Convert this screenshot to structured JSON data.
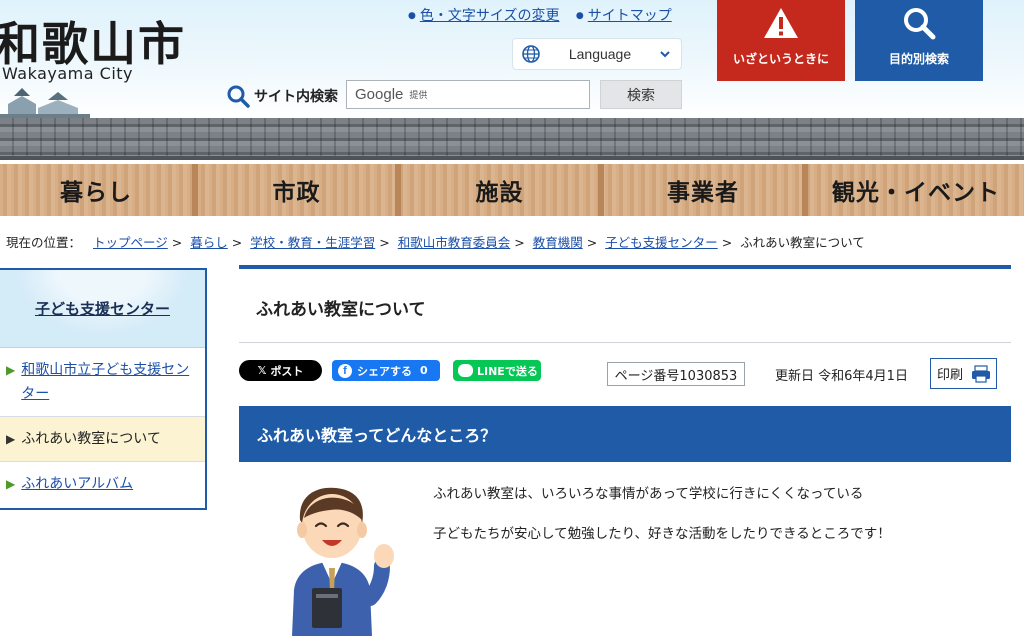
{
  "header": {
    "logo_title": "和歌山市",
    "logo_subtitle": "Wakayama City",
    "top_links": [
      "色・文字サイズの変更",
      "サイトマップ"
    ],
    "language_label": "Language",
    "search_label": "サイト内検索",
    "search_placeholder_brand": "Google",
    "search_placeholder_suffix": "提供",
    "search_button": "検索",
    "emergency_button": "いざというときに",
    "purpose_button": "目的別検索",
    "colors": {
      "emergency": "#c5281c",
      "purpose": "#1f5ba7"
    }
  },
  "nav": {
    "items": [
      "暮らし",
      "市政",
      "施設",
      "事業者",
      "観光・イベント"
    ]
  },
  "breadcrumb": {
    "prefix": "現在の位置：",
    "links": [
      "トップページ",
      "暮らし",
      "学校・教育・生涯学習",
      "和歌山市教育委員会",
      "教育機関",
      "子ども支援センター"
    ],
    "current": "ふれあい教室について"
  },
  "sidebar": {
    "heading": "子ども支援センター",
    "items": [
      {
        "label": "和歌山市立子ども支援センター",
        "current": false
      },
      {
        "label": "ふれあい教室について",
        "current": true
      },
      {
        "label": "ふれあいアルバム",
        "current": false
      }
    ]
  },
  "main": {
    "title": "ふれあい教室について",
    "share": {
      "x_label": "ポスト",
      "x_glyph": "𝕏",
      "fb_label": "シェアする",
      "fb_count": "0",
      "line_label": "LINEで送る"
    },
    "page_number": "ページ番号1030853",
    "updated": "更新日 令和6年4月1日",
    "print_label": "印刷",
    "section_heading": "ふれあい教室ってどんなところ？",
    "paragraphs": [
      "ふれあい教室は、いろいろな事情があって学校に行きにくくなっている",
      "子どもたちが安心して勉強したり、好きな活動をしたりできるところです！"
    ]
  }
}
